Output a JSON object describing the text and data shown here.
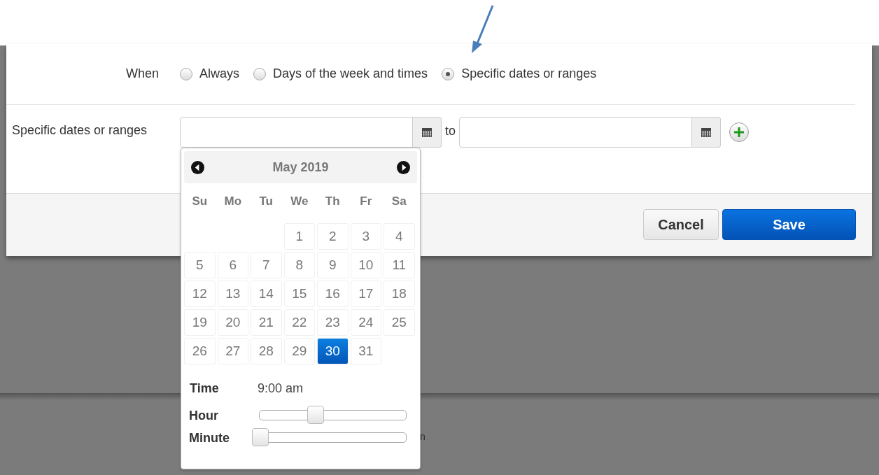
{
  "when": {
    "label": "When",
    "options": [
      {
        "label": "Always",
        "selected": false
      },
      {
        "label": "Days of the week and times",
        "selected": false
      },
      {
        "label": "Specific dates or ranges",
        "selected": true
      }
    ]
  },
  "dates": {
    "label": "Specific dates or ranges",
    "separator": "to"
  },
  "datepicker": {
    "month": "May 2019",
    "weekdays": [
      "Su",
      "Mo",
      "Tu",
      "We",
      "Th",
      "Fr",
      "Sa"
    ],
    "weeks": [
      [
        {
          "kind": "empty"
        },
        {
          "kind": "empty"
        },
        {
          "kind": "empty"
        },
        {
          "day": "1",
          "selected": false
        },
        {
          "day": "2",
          "selected": false
        },
        {
          "day": "3",
          "selected": false
        },
        {
          "day": "4",
          "selected": false
        }
      ],
      [
        {
          "day": "5",
          "selected": false
        },
        {
          "day": "6",
          "selected": false
        },
        {
          "day": "7",
          "selected": false
        },
        {
          "day": "8",
          "selected": false
        },
        {
          "day": "9",
          "selected": false
        },
        {
          "day": "10",
          "selected": false
        },
        {
          "day": "11",
          "selected": false
        }
      ],
      [
        {
          "day": "12",
          "selected": false
        },
        {
          "day": "13",
          "selected": false
        },
        {
          "day": "14",
          "selected": false
        },
        {
          "day": "15",
          "selected": false
        },
        {
          "day": "16",
          "selected": false
        },
        {
          "day": "17",
          "selected": false
        },
        {
          "day": "18",
          "selected": false
        }
      ],
      [
        {
          "day": "19",
          "selected": false
        },
        {
          "day": "20",
          "selected": false
        },
        {
          "day": "21",
          "selected": false
        },
        {
          "day": "22",
          "selected": false
        },
        {
          "day": "23",
          "selected": false
        },
        {
          "day": "24",
          "selected": false
        },
        {
          "day": "25",
          "selected": false
        }
      ],
      [
        {
          "day": "26",
          "selected": false
        },
        {
          "day": "27",
          "selected": false
        },
        {
          "day": "28",
          "selected": false
        },
        {
          "day": "29",
          "selected": false
        },
        {
          "day": "30",
          "selected": true
        },
        {
          "day": "31",
          "selected": false
        },
        {
          "kind": "empty"
        }
      ]
    ],
    "time_label": "Time",
    "time_value": "9:00 am",
    "sliders": [
      {
        "label": "Hour",
        "level": 0.4
      },
      {
        "label": "Minute",
        "level": 0
      }
    ]
  },
  "buttons": [
    {
      "label": "Cancel",
      "kind": "secondary"
    },
    {
      "label": "Save",
      "kind": "primary"
    }
  ],
  "background_fragment": "n"
}
